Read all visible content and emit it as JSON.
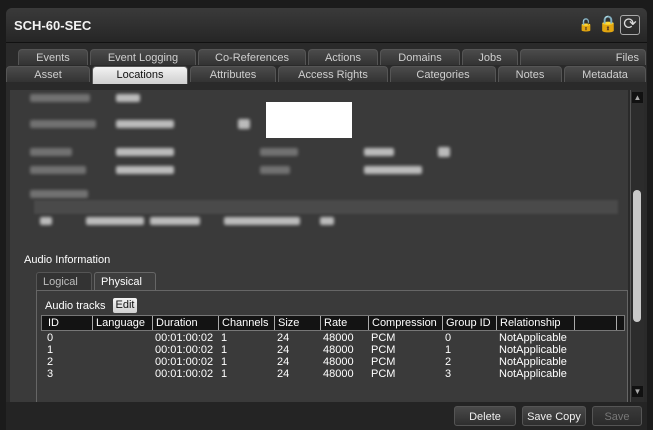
{
  "window": {
    "title": "SCH-60-SEC"
  },
  "tabs_top": [
    "Events",
    "Event Logging",
    "Co-References",
    "Actions",
    "Domains",
    "Jobs",
    "Files"
  ],
  "tabs_bottom": [
    "Asset",
    "Locations",
    "Attributes",
    "Access Rights",
    "Categories",
    "Notes",
    "Metadata"
  ],
  "active_tab": "Locations",
  "audio": {
    "section_title": "Audio Information",
    "subtabs": [
      "Logical",
      "Physical"
    ],
    "active_subtab": "Physical",
    "tracks_label": "Audio tracks",
    "edit_label": "Edit",
    "columns": [
      "ID",
      "Language",
      "Duration",
      "Channels",
      "Size",
      "Rate",
      "Compression",
      "Group ID",
      "Relationship"
    ],
    "rows": [
      [
        "0",
        "",
        "00:01:00:02",
        "1",
        "24",
        "48000",
        "PCM",
        "0",
        "NotApplicable"
      ],
      [
        "1",
        "",
        "00:01:00:02",
        "1",
        "24",
        "48000",
        "PCM",
        "1",
        "NotApplicable"
      ],
      [
        "2",
        "",
        "00:01:00:02",
        "1",
        "24",
        "48000",
        "PCM",
        "2",
        "NotApplicable"
      ],
      [
        "3",
        "",
        "00:01:00:02",
        "1",
        "24",
        "48000",
        "PCM",
        "3",
        "NotApplicable"
      ]
    ]
  },
  "footer": {
    "delete": "Delete",
    "save_copy": "Save Copy",
    "save": "Save"
  },
  "icons": {
    "lock_small": "lock-icon",
    "lock_large": "lock-icon",
    "refresh": "refresh-icon"
  }
}
